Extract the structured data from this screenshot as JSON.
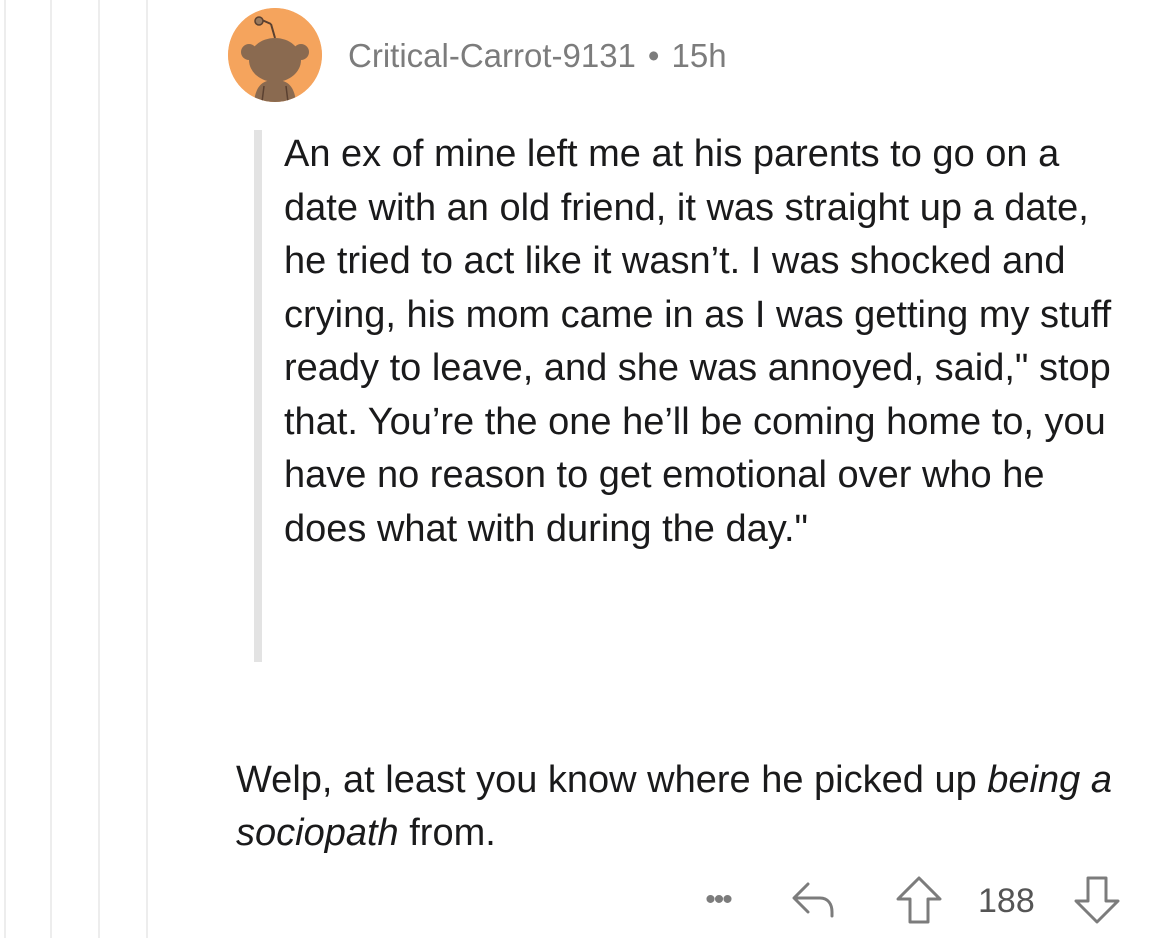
{
  "comment": {
    "author": "Critical-Carrot-9131",
    "separator": "•",
    "age": "15h",
    "avatar": {
      "icon": "snoo-avatar-icon",
      "background_color": "#f5a45d"
    },
    "quote": "An ex of mine left me at his parents to go on a date with an old friend, it was straight up a date, he tried to act like it wasn’t. I was shocked and crying, his mom came in as I was getting my stuff ready to leave, and she was annoyed, said,\" stop that. You’re the one he’ll be coming home to, you have no reason to get emotional over who he does what with during the day.\"",
    "reply": {
      "before_emphasis": "Welp, at least you know where he picked up ",
      "emphasis": "being a sociopath",
      "after_emphasis": " from."
    }
  },
  "actions": {
    "more_label": "•••",
    "reply_icon": "reply-arrow-icon",
    "upvote_icon": "upvote-arrow-icon",
    "score": "188",
    "downvote_icon": "downvote-arrow-icon"
  },
  "colors": {
    "text": "#1a1a1b",
    "meta": "#7c7c7c",
    "quote_bar": "#e3e3e3",
    "thread_line": "#ededed"
  }
}
